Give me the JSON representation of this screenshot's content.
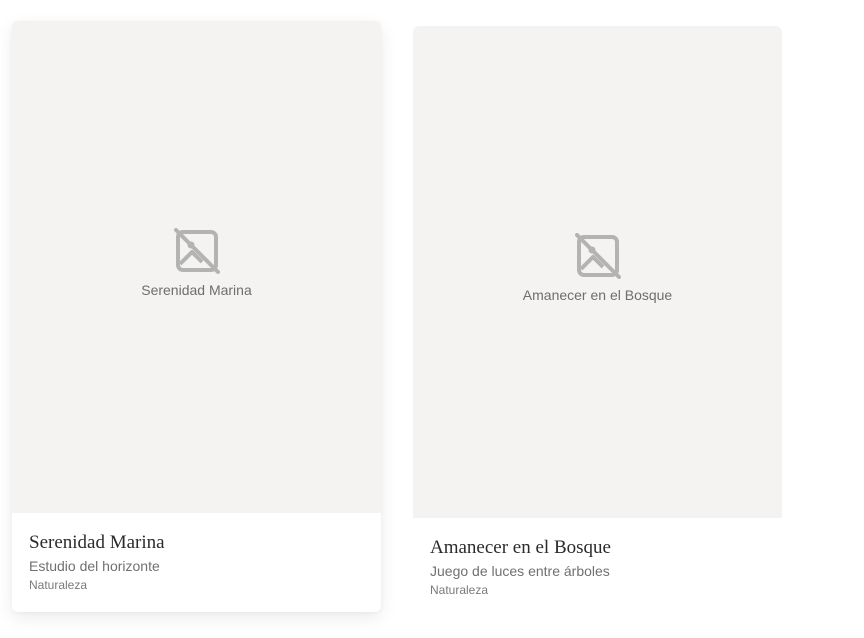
{
  "cards": [
    {
      "image_placeholder_label": "Serenidad Marina",
      "image_icon": "image-off-icon",
      "title": "Serenidad Marina",
      "subtitle": "Estudio del horizonte",
      "category": "Naturaleza"
    },
    {
      "image_placeholder_label": "Amanecer en el Bosque",
      "image_icon": "image-off-icon",
      "title": "Amanecer en el Bosque",
      "subtitle": "Juego de luces entre árboles",
      "category": "Naturaleza"
    }
  ],
  "colors": {
    "thumbnail_bg": "#f4f3f1",
    "icon": "#b3b3b3",
    "title": "#2b2b2b",
    "subtitle": "#707070"
  }
}
